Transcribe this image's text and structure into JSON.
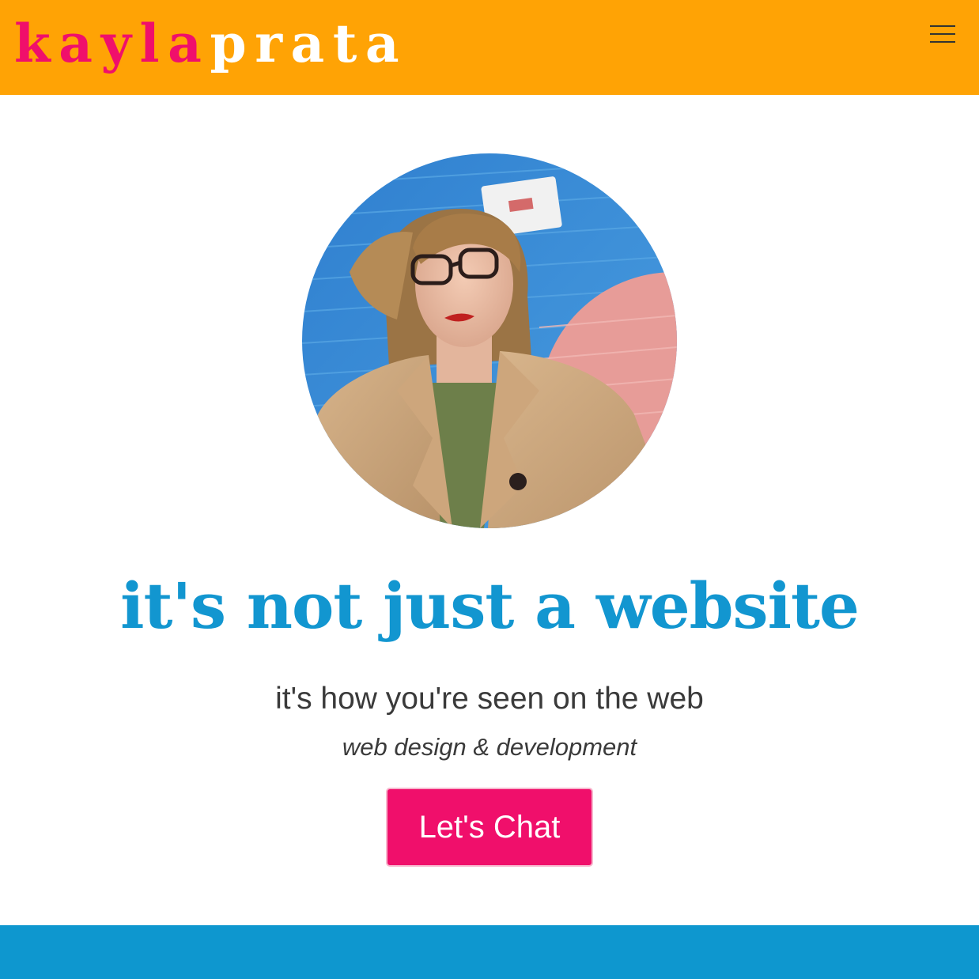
{
  "header": {
    "logo_first": "kayla",
    "logo_last": "prata",
    "menu_icon": "hamburger-menu-icon"
  },
  "hero": {
    "photo_description_icon": "portrait-photo",
    "headline": "it's not just a website",
    "subtitle": "it's how you're seen on the web",
    "tagline": "web design & development",
    "cta_label": "Let's Chat"
  },
  "next_section": {
    "heading": ""
  },
  "colors": {
    "header_bg": "#ffa305",
    "brand_pink": "#f00f6b",
    "brand_blue": "#1296d0",
    "band_blue": "#0e97cf",
    "text_dark": "#3a3a3a"
  }
}
